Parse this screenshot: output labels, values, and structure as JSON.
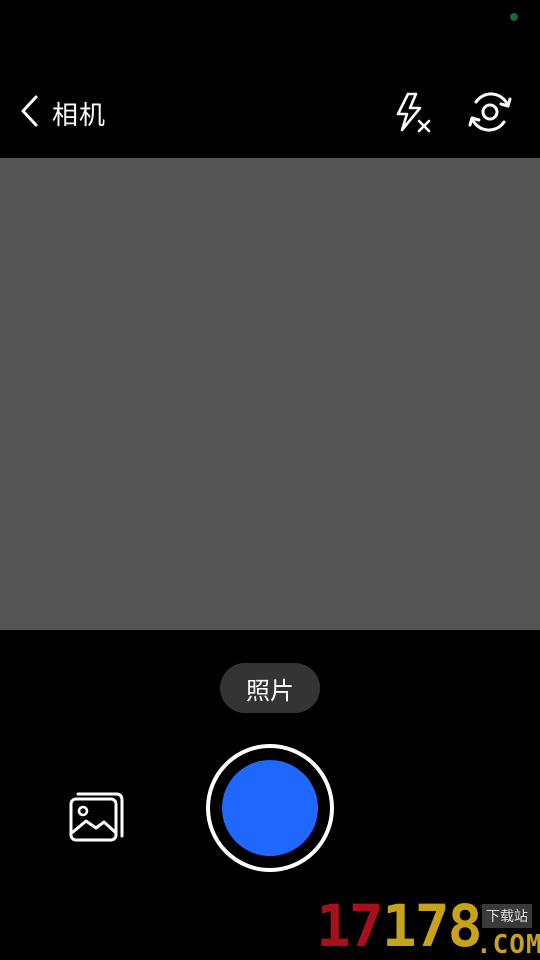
{
  "status_bar": {
    "indicator_color": "#0f6a35"
  },
  "header": {
    "back_icon": "chevron-left-icon",
    "title": "相机",
    "flash_icon": "flash-off-icon",
    "switch_icon": "switch-camera-icon"
  },
  "viewfinder": {
    "color": "#545454"
  },
  "mode": {
    "label": "照片"
  },
  "controls": {
    "gallery_icon": "gallery-icon",
    "shutter_color": "#1f67ff"
  },
  "watermark": {
    "number_red": "17",
    "number_yellow": "178",
    "sub": "下载站",
    "domain": ".COM"
  }
}
